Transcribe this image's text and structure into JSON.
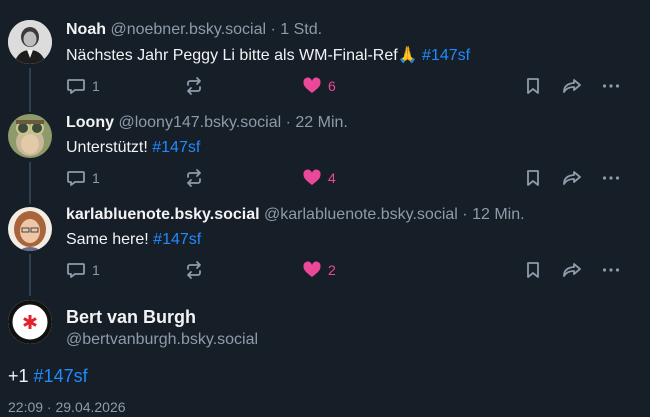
{
  "posts": [
    {
      "name": "Noah",
      "handle": "@noebner.bsky.social",
      "time": "· 1 Std.",
      "text": "Nächstes Jahr Peggy Li bitte als WM-Final-Ref🙏",
      "tag": "#147sf",
      "replies": "1",
      "likes": "6"
    },
    {
      "name": "Loony",
      "handle": "@loony147.bsky.social",
      "time": "· 22 Min.",
      "text": "Unterstützt! ",
      "tag": "#147sf",
      "replies": "1",
      "likes": "4"
    },
    {
      "name": "karlabluenote.bsky.social",
      "handle": "@karlabluenote.bsky.social",
      "time": "· 12 Min.",
      "text": "Same here!",
      "tag": "#147sf",
      "replies": "1",
      "likes": "2"
    }
  ],
  "main_post": {
    "name": "Bert van Burgh",
    "handle": "@bertvanburgh.bsky.social",
    "text": "+1",
    "tag": "#147sf",
    "timestamp": "22:09 · 29.04.2026"
  },
  "colors": {
    "background": "#161e27",
    "link": "#208bfe",
    "like": "#ec4899",
    "muted": "#8d9bab"
  }
}
